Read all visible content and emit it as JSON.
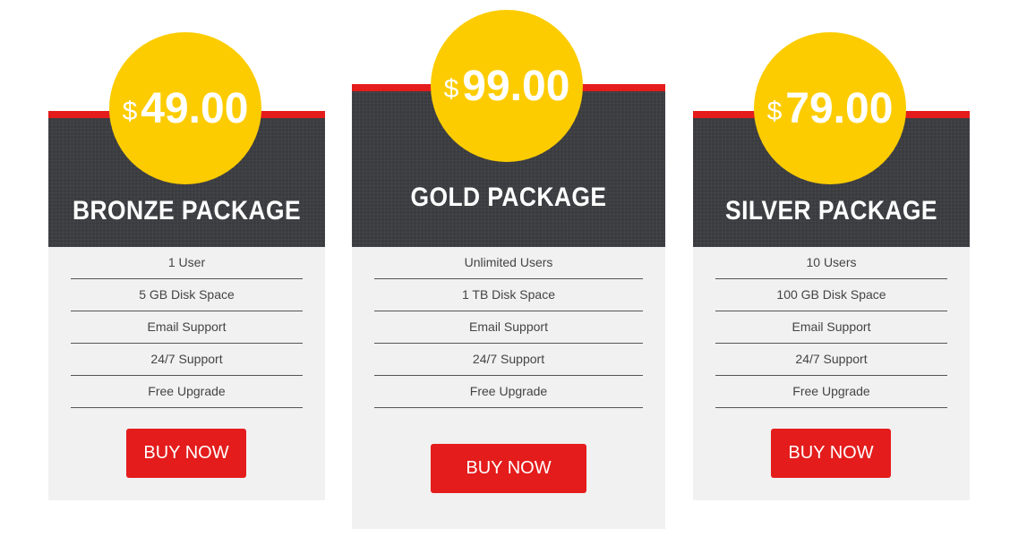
{
  "colors": {
    "accent_red": "#e41c1c",
    "price_yellow": "#fccc00",
    "header_dark": "#3a3b3f",
    "card_bg": "#f1f1f1"
  },
  "plans": [
    {
      "currency": "$",
      "price": "49.00",
      "title": "BRONZE PACKAGE",
      "features": [
        "1 User",
        "5 GB Disk Space",
        "Email Support",
        "24/7 Support",
        "Free Upgrade"
      ],
      "button_label": "BUY NOW"
    },
    {
      "currency": "$",
      "price": "99.00",
      "title": "GOLD PACKAGE",
      "features": [
        "Unlimited Users",
        "1 TB Disk Space",
        "Email Support",
        "24/7 Support",
        "Free Upgrade"
      ],
      "button_label": "BUY NOW"
    },
    {
      "currency": "$",
      "price": "79.00",
      "title": "SILVER PACKAGE",
      "features": [
        "10 Users",
        "100 GB Disk Space",
        "Email Support",
        "24/7 Support",
        "Free Upgrade"
      ],
      "button_label": "BUY NOW"
    }
  ]
}
